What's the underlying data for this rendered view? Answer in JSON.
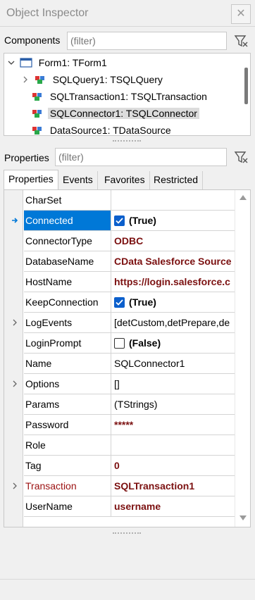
{
  "window": {
    "title": "Object Inspector",
    "close_glyph": "✕"
  },
  "components": {
    "label": "Components",
    "filter_placeholder": "(filter)",
    "tree": [
      {
        "label": "Form1: TForm1",
        "level": 0,
        "expanded": true,
        "icon": "form-icon"
      },
      {
        "label": "SQLQuery1: TSQLQuery",
        "level": 1,
        "expandable": true,
        "icon": "component-icon"
      },
      {
        "label": "SQLTransaction1: TSQLTransaction",
        "level": 1,
        "icon": "component-icon"
      },
      {
        "label": "SQLConnector1: TSQLConnector",
        "level": 1,
        "selected": true,
        "icon": "component-icon"
      },
      {
        "label": "DataSource1: TDataSource",
        "level": 1,
        "icon": "component-icon"
      }
    ]
  },
  "properties_filter": {
    "label": "Properties",
    "placeholder": "(filter)"
  },
  "tabs": [
    "Properties",
    "Events",
    "Favorites",
    "Restricted"
  ],
  "properties": [
    {
      "name": "CharSet",
      "value": ""
    },
    {
      "name": "Connected",
      "value": "(True)",
      "checkbox": true,
      "checked": true,
      "selected": true
    },
    {
      "name": "ConnectorType",
      "value": "ODBC",
      "style": "bold"
    },
    {
      "name": "DatabaseName",
      "value": "CData Salesforce Source",
      "style": "bold"
    },
    {
      "name": "HostName",
      "value": "https://login.salesforce.c",
      "style": "bold"
    },
    {
      "name": "KeepConnection",
      "value": "(True)",
      "checkbox": true,
      "checked": true
    },
    {
      "name": "LogEvents",
      "value": "[detCustom,detPrepare,de",
      "expandable": true
    },
    {
      "name": "LoginPrompt",
      "value": "(False)",
      "checkbox": true,
      "checked": false
    },
    {
      "name": "Name",
      "value": "SQLConnector1"
    },
    {
      "name": "Options",
      "value": "[]",
      "expandable": true
    },
    {
      "name": "Params",
      "value": "(TStrings)"
    },
    {
      "name": "Password",
      "value": "*****",
      "style": "bold"
    },
    {
      "name": "Role",
      "value": ""
    },
    {
      "name": "Tag",
      "value": "0",
      "style": "bold"
    },
    {
      "name": "Transaction",
      "value": "SQLTransaction1",
      "style": "bold",
      "name_red": true,
      "expandable": true
    },
    {
      "name": "UserName",
      "value": "username",
      "style": "bold"
    }
  ],
  "colors": {
    "selection": "#0078d7",
    "modified_value": "#7b1010",
    "checkbox": "#0b5fcc"
  }
}
